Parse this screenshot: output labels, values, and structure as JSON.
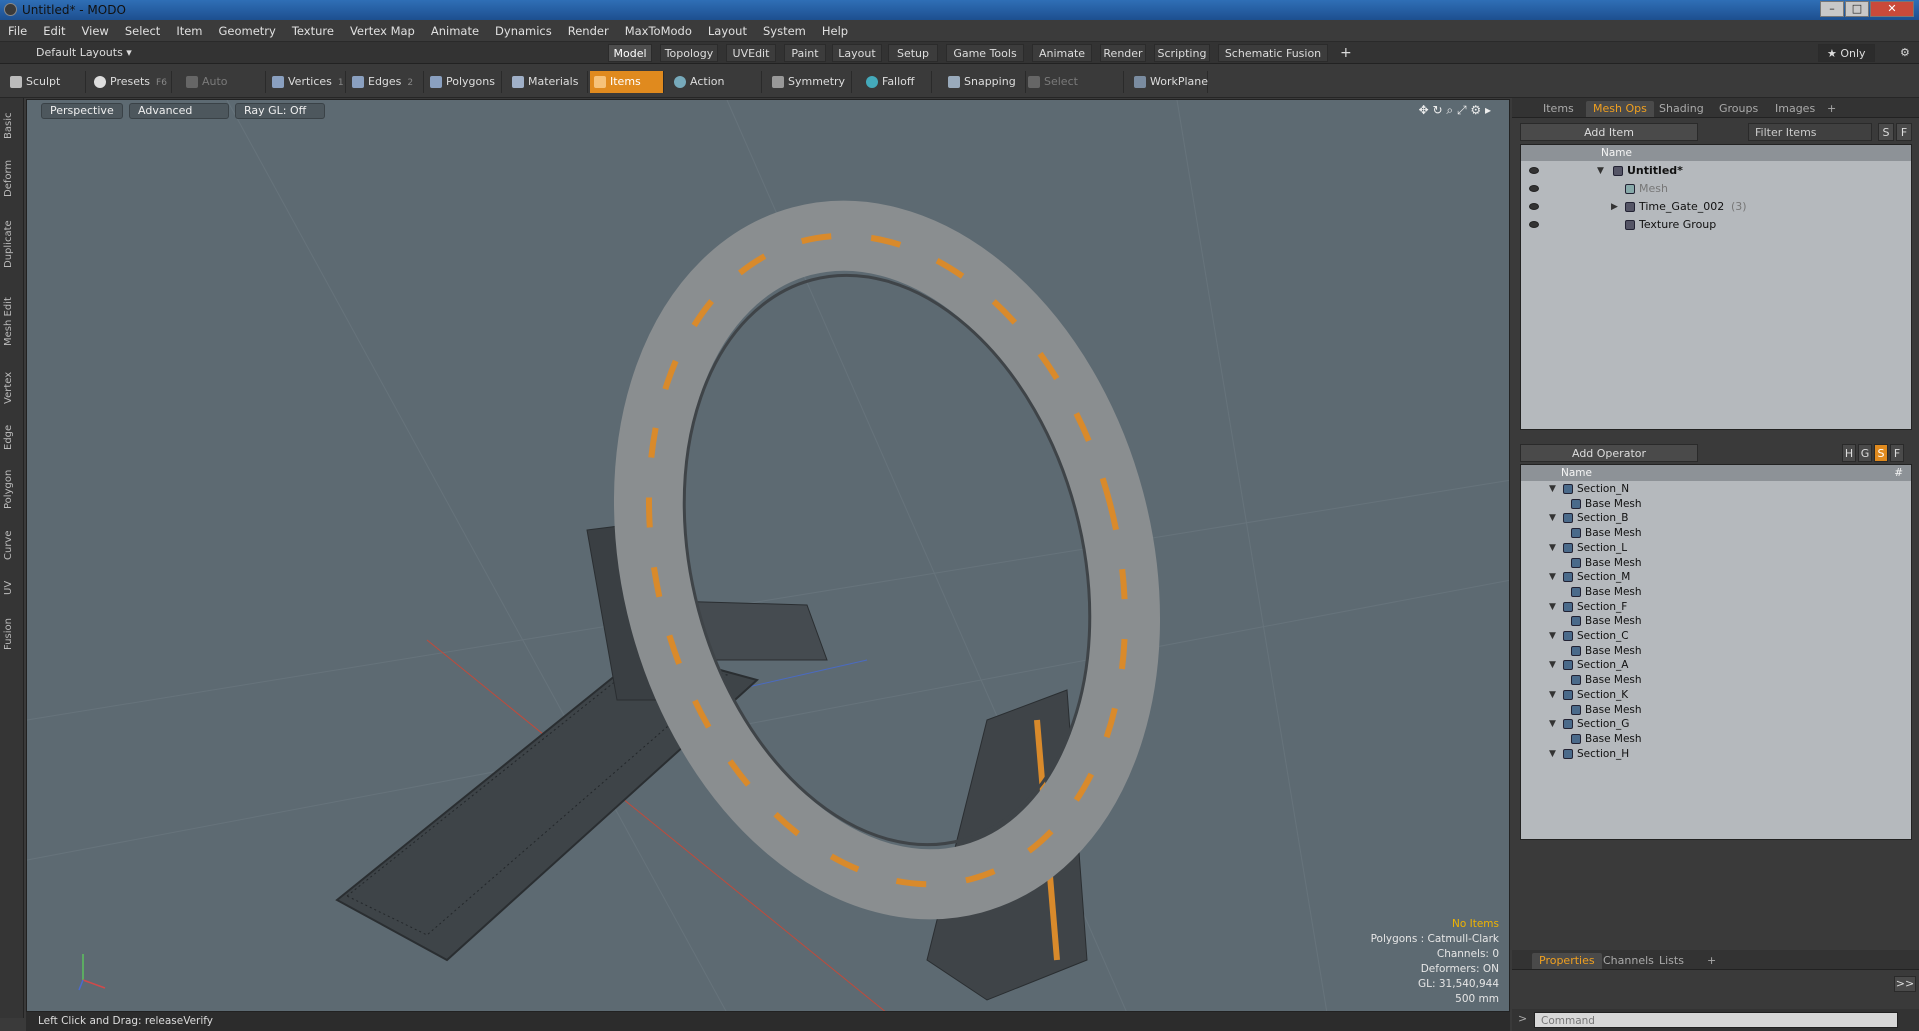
{
  "window": {
    "title": "Untitled* - MODO",
    "min": "–",
    "max": "□",
    "close": "✕"
  },
  "menu": [
    "File",
    "Edit",
    "View",
    "Select",
    "Item",
    "Geometry",
    "Texture",
    "Vertex Map",
    "Animate",
    "Dynamics",
    "Render",
    "MaxToModo",
    "Layout",
    "System",
    "Help"
  ],
  "layout": {
    "preset": "Default Layouts ▾",
    "tabs": [
      "Model",
      "Topology",
      "UVEdit",
      "Paint",
      "Layout",
      "Setup",
      "Game Tools",
      "Animate",
      "Render",
      "Scripting",
      "Schematic Fusion"
    ],
    "add": "+",
    "only": "★ Only",
    "gear": "⚙"
  },
  "toolbar": {
    "sculpt": "Sculpt",
    "presets": "Presets",
    "presets_key": "F6",
    "auto_select": "Auto Select",
    "vertices": "Vertices",
    "vertices_key": "1",
    "edges": "Edges",
    "edges_key": "2",
    "polygons": "Polygons",
    "materials": "Materials",
    "items": "Items",
    "action_center": "Action Center",
    "symmetry": "Symmetry",
    "falloff": "Falloff",
    "snapping": "Snapping",
    "select_through": "Select Through",
    "workplane": "WorkPlane"
  },
  "left_tabs": [
    "Basic",
    "Deform",
    "Duplicate",
    "Mesh Edit",
    "Vertex",
    "Edge",
    "Polygon",
    "Curve",
    "UV",
    "Fusion"
  ],
  "viewport": {
    "view": "Perspective",
    "shading": "Advanced",
    "raygl": "Ray GL: Off",
    "info": {
      "items": "No Items",
      "polygons": "Polygons : Catmull-Clark",
      "channels": "Channels: 0",
      "deformers": "Deformers: ON",
      "gl": "GL: 31,540,944",
      "scale": "500 mm"
    }
  },
  "status": "Left Click and Drag:   releaseVerify",
  "items_panel": {
    "tabs": [
      "Items",
      "Mesh Ops",
      "Shading",
      "Groups",
      "Images",
      "+"
    ],
    "add_item": "Add Item",
    "filter": "Filter Items",
    "s": "S",
    "f": "F",
    "col_name": "Name",
    "tree": [
      {
        "label": "Untitled*",
        "extra": "",
        "indent": 0,
        "bold": true,
        "dim": false
      },
      {
        "label": "Mesh",
        "extra": "",
        "indent": 1,
        "bold": false,
        "dim": true
      },
      {
        "label": "Time_Gate_002",
        "extra": "(3)",
        "indent": 1,
        "bold": false,
        "dim": false
      },
      {
        "label": "Texture Group",
        "extra": "",
        "indent": 1,
        "bold": false,
        "dim": false
      }
    ]
  },
  "meshops_panel": {
    "add_operator": "Add Operator",
    "h": "H",
    "g": "G",
    "s": "S",
    "f": "F",
    "col_name": "Name",
    "col_hash": "#",
    "rows": [
      {
        "label": "Section_N",
        "child": false
      },
      {
        "label": "Base Mesh",
        "child": true
      },
      {
        "label": "Section_B",
        "child": false
      },
      {
        "label": "Base Mesh",
        "child": true
      },
      {
        "label": "Section_L",
        "child": false
      },
      {
        "label": "Base Mesh",
        "child": true
      },
      {
        "label": "Section_M",
        "child": false
      },
      {
        "label": "Base Mesh",
        "child": true
      },
      {
        "label": "Section_F",
        "child": false
      },
      {
        "label": "Base Mesh",
        "child": true
      },
      {
        "label": "Section_C",
        "child": false
      },
      {
        "label": "Base Mesh",
        "child": true
      },
      {
        "label": "Section_A",
        "child": false
      },
      {
        "label": "Base Mesh",
        "child": true
      },
      {
        "label": "Section_K",
        "child": false
      },
      {
        "label": "Base Mesh",
        "child": true
      },
      {
        "label": "Section_G",
        "child": false
      },
      {
        "label": "Base Mesh",
        "child": true
      },
      {
        "label": "Section_H",
        "child": false
      }
    ]
  },
  "props_panel": {
    "tabs": [
      "Properties",
      "Channels",
      "Lists",
      "+"
    ],
    "expand": ">>"
  },
  "command": {
    "placeholder": "Command",
    "arrow": ">"
  },
  "colors": {
    "accent": "#e08a1e",
    "viewport_bg": "#5d6a72"
  }
}
